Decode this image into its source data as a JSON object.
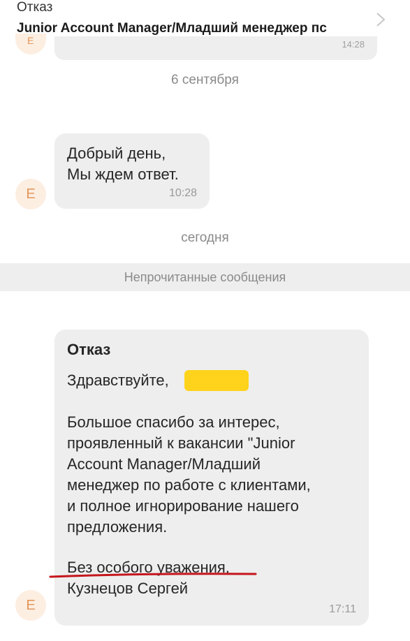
{
  "header": {
    "status": "Отказ",
    "title": "Junior Account Manager/Младший менеджер пс"
  },
  "previous": {
    "avatar_letter": "Е",
    "time": "14:28"
  },
  "dates": {
    "first": "6 сентября",
    "second": "сегодня"
  },
  "message1": {
    "lines": [
      "Добрый день,",
      "Мы ждем ответ."
    ],
    "time": "10:28",
    "avatar_letter": "Е"
  },
  "unread": "Непрочитанные сообщения",
  "message2": {
    "subject": "Отказ",
    "greeting": "Здравствуйте,",
    "body": [
      "Большое спасибо за интерес,",
      "проявленный к вакансии \"Junior",
      "Account Manager/Младший",
      "менеджер по работе с клиентами,",
      "и полное игнорирование нашего",
      "предложения."
    ],
    "closing": "Без особого уважения,",
    "signature": "Кузнецов Сергей",
    "time": "17:11",
    "avatar_letter": "Е"
  },
  "colors": {
    "bubble": "#eeeeee",
    "avatar_bg": "#fdeee2",
    "avatar_letter": "#e2975a",
    "highlight": "#ffd21c",
    "underline": "#c4161c"
  }
}
